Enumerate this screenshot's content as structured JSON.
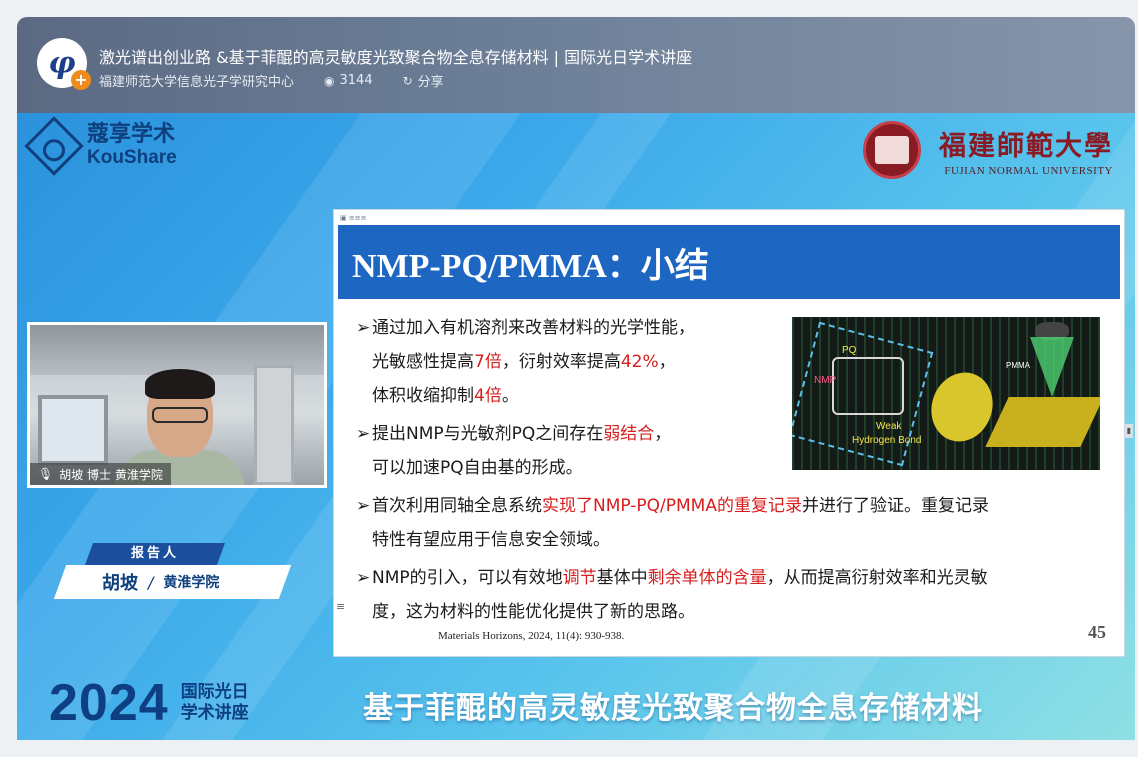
{
  "header": {
    "title": "激光谱出创业路 &基于菲醌的高灵敏度光致聚合物全息存储材料 | 国际光日学术讲座",
    "channel": "福建师范大学信息光子学研究中心",
    "views": "3144",
    "share_label": "分享",
    "avatar_icon": "channel-logo-icon"
  },
  "video": {
    "logo": {
      "cn": "蔻享学术",
      "en": "KouShare"
    },
    "university": {
      "cn": "福建師範大學",
      "en": "FUJIAN NORMAL UNIVERSITY"
    },
    "webcam_name": "胡坡 博士 黄淮学院",
    "reporter": {
      "tag": "报告人",
      "name": "胡坡",
      "separator": "/",
      "org": "黄淮学院"
    },
    "year": "2024",
    "event_line1": "国际光日",
    "event_line2": "学术讲座",
    "subtitle": "基于菲醌的高灵敏度光致聚合物全息存储材料"
  },
  "slide": {
    "title": "NMP-PQ/PMMA：小结",
    "bullets": [
      {
        "text": "通过加入有机溶剂来改善材料的光学性能，"
      },
      {
        "prefix": "光敏感性提高",
        "red1": "7倍",
        "mid": "，衍射效率提高",
        "red2": "42%",
        "suffix": "，"
      },
      {
        "prefix": "体积收缩抑制",
        "red1": "4倍",
        "suffix": "。"
      },
      {
        "prefix": "提出NMP与光敏剂PQ之间存在",
        "red1": "弱结合",
        "suffix": "，"
      },
      {
        "text": "可以加速PQ自由基的形成。"
      },
      {
        "prefix": "首次利用同轴全息系统",
        "red1": "实现了NMP-PQ/PMMA的重复记录",
        "suffix": "并进行了验证。重复记录"
      },
      {
        "text": "特性有望应用于信息安全领域。"
      },
      {
        "prefix": "NMP的引入，可以有效地",
        "red1": "调节",
        "mid": "基体中",
        "red2": "剩余单体的含量",
        "suffix": "，从而提高衍射效率和光灵敏"
      },
      {
        "text": "度，这为材料的性能优化提供了新的思路。"
      }
    ],
    "figure_labels": {
      "pq": "PQ",
      "nmp": "NMP",
      "weak": "Weak",
      "hbond": "Hydrogen Bond",
      "pmma": "PMMA"
    },
    "reference": "Materials Horizons, 2024, 11(4): 930-938.",
    "page_number": "45"
  },
  "colors": {
    "accent_blue": "#1d66c2",
    "highlight_red": "#d81d1d",
    "brand_navy": "#0f3f7e"
  }
}
